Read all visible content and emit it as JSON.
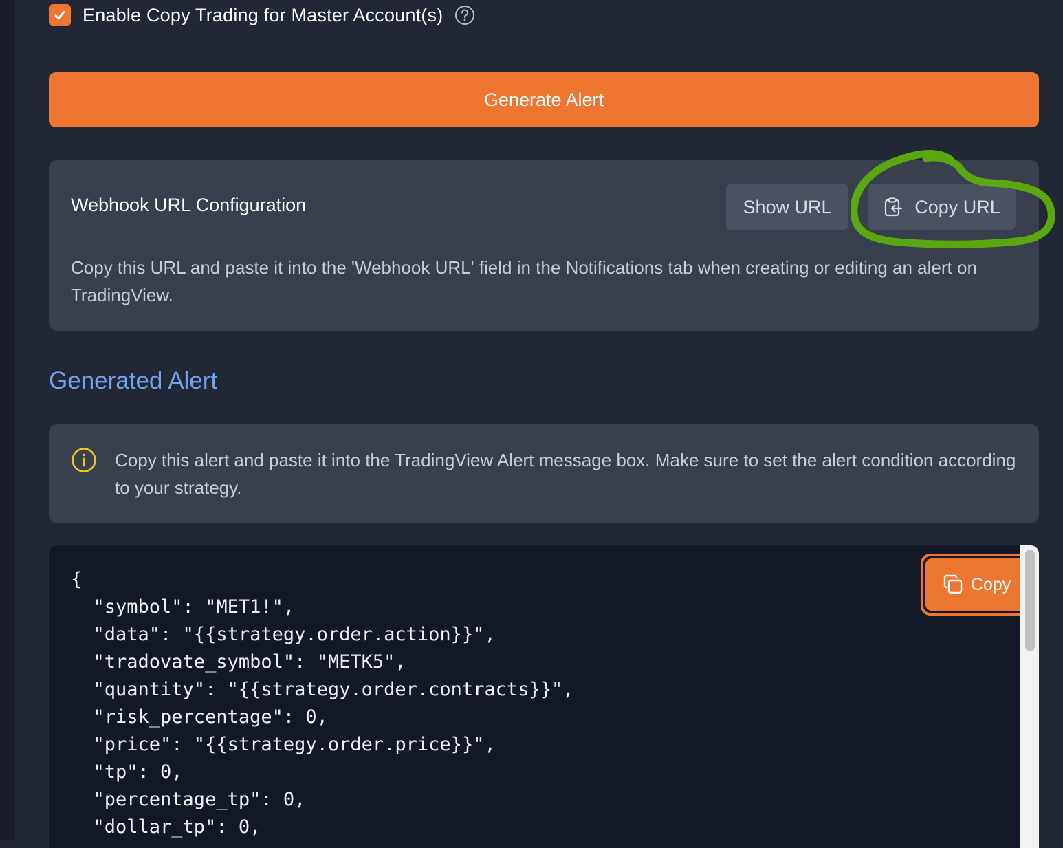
{
  "copy_trading": {
    "checked": true,
    "label": "Enable Copy Trading for Master Account(s)",
    "help_icon": "question-circle-icon"
  },
  "generate_button": {
    "label": "Generate Alert"
  },
  "webhook": {
    "title": "Webhook URL Configuration",
    "show_url_label": "Show URL",
    "copy_url_label": "Copy URL",
    "copy_url_icon": "clipboard-arrow-icon",
    "description": "Copy this URL and paste it into the 'Webhook URL' field in the Notifications tab when creating or editing an alert on TradingView."
  },
  "generated_alert": {
    "heading": "Generated Alert",
    "info_icon": "info-circle-icon",
    "info_text": "Copy this alert and paste it into the TradingView Alert message box. Make sure to set the alert condition according to your strategy.",
    "copy_label": "Copy",
    "copy_icon": "copy-icon",
    "code_lines": [
      "{",
      "  \"symbol\": \"MET1!\",",
      "  \"data\": \"{{strategy.order.action}}\",",
      "  \"tradovate_symbol\": \"METK5\",",
      "  \"quantity\": \"{{strategy.order.contracts}}\",",
      "  \"risk_percentage\": 0,",
      "  \"price\": \"{{strategy.order.price}}\",",
      "  \"tp\": 0,",
      "  \"percentage_tp\": 0,",
      "  \"dollar_tp\": 0,"
    ]
  },
  "colors": {
    "accent_orange": "#ee7631",
    "heading_blue": "#6fa3ee",
    "annotation_green": "#5aa712",
    "info_yellow": "#f2c41d"
  }
}
